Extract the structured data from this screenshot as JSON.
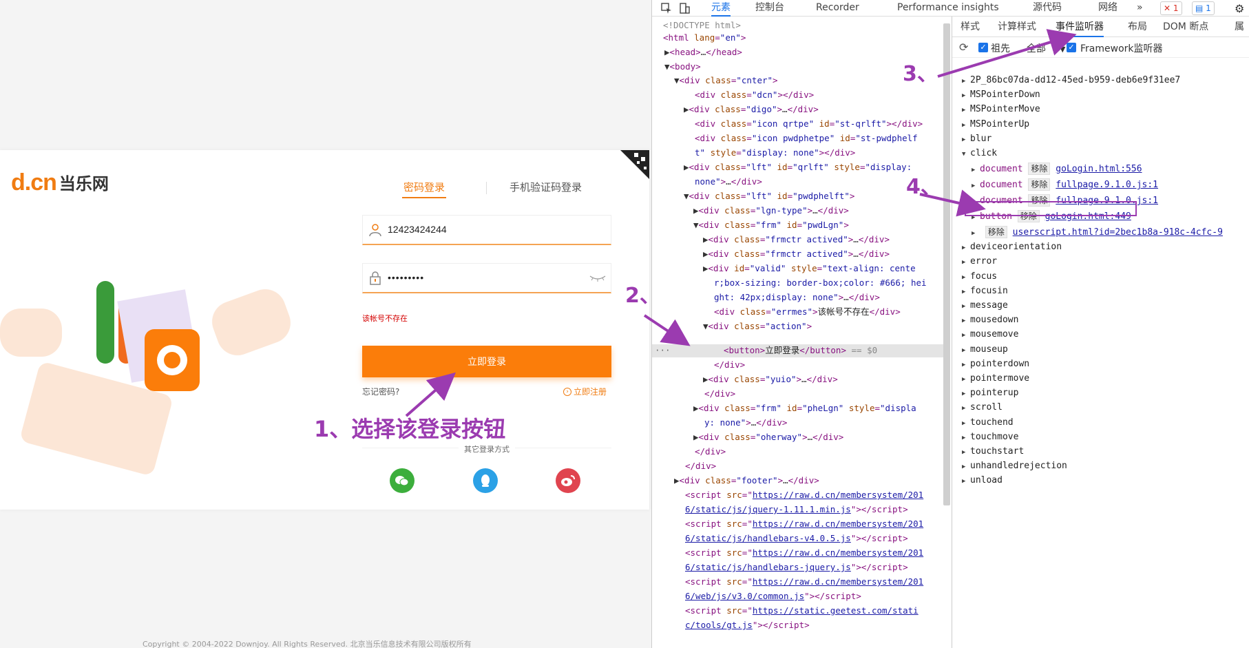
{
  "page": {
    "logo_dcn": "d.cn",
    "logo_cn": "当乐网",
    "tabs": [
      "密码登录",
      "手机验证码登录"
    ],
    "username_value": "12423424244",
    "password_value": "•••••••••",
    "error": "该帐号不存在",
    "login_button": "立即登录",
    "forgot": "忘记密码?",
    "register": "立即注册",
    "other_login": "其它登录方式",
    "annotation": "1、选择该登录按钮",
    "copyright": "Copyright © 2004-2022 Downjoy. All Rights Reserved. 北京当乐信息技术有限公司版权所有"
  },
  "devtools": {
    "tabs": [
      "元素",
      "控制台",
      "Recorder",
      "Performance insights",
      "源代码",
      "网络"
    ],
    "more": "»",
    "error_count": "1",
    "message_count": "1",
    "elements": {
      "doctype": "<!DOCTYPE html>",
      "selected_suffix": " == $0",
      "dots": "···"
    },
    "right_tabs": [
      "样式",
      "计算样式",
      "事件监听器",
      "布局",
      "DOM 断点",
      "属"
    ],
    "toolbar": {
      "ancestors": "祖先",
      "all": "全部",
      "framework": "Framework监听器"
    },
    "events": [
      "2P_86bc07da-dd12-45ed-b959-deb6e9f31ee7",
      "MSPointerDown",
      "MSPointerMove",
      "MSPointerUp",
      "blur",
      "click",
      "deviceorientation",
      "error",
      "focus",
      "focusin",
      "message",
      "mousedown",
      "mousemove",
      "mouseup",
      "pointerdown",
      "pointermove",
      "pointerup",
      "scroll",
      "touchend",
      "touchmove",
      "touchstart",
      "unhandledrejection",
      "unload"
    ],
    "click_listeners": [
      {
        "target": "document",
        "remove": "移除",
        "link": "goLogin.html:556"
      },
      {
        "target": "document",
        "remove": "移除",
        "link": "fullpage.9.1.0.js:1"
      },
      {
        "target": "document",
        "remove": "移除",
        "link": "fullpage.9.1.0.js:1"
      },
      {
        "target": "button",
        "remove": "移除",
        "link": "goLogin.html:449"
      },
      {
        "target": "",
        "remove": "移除",
        "link": "userscript.html?id=2bec1b8a-918c-4cfc-9"
      }
    ],
    "annotations": [
      "2、",
      "3、",
      "4、"
    ]
  }
}
